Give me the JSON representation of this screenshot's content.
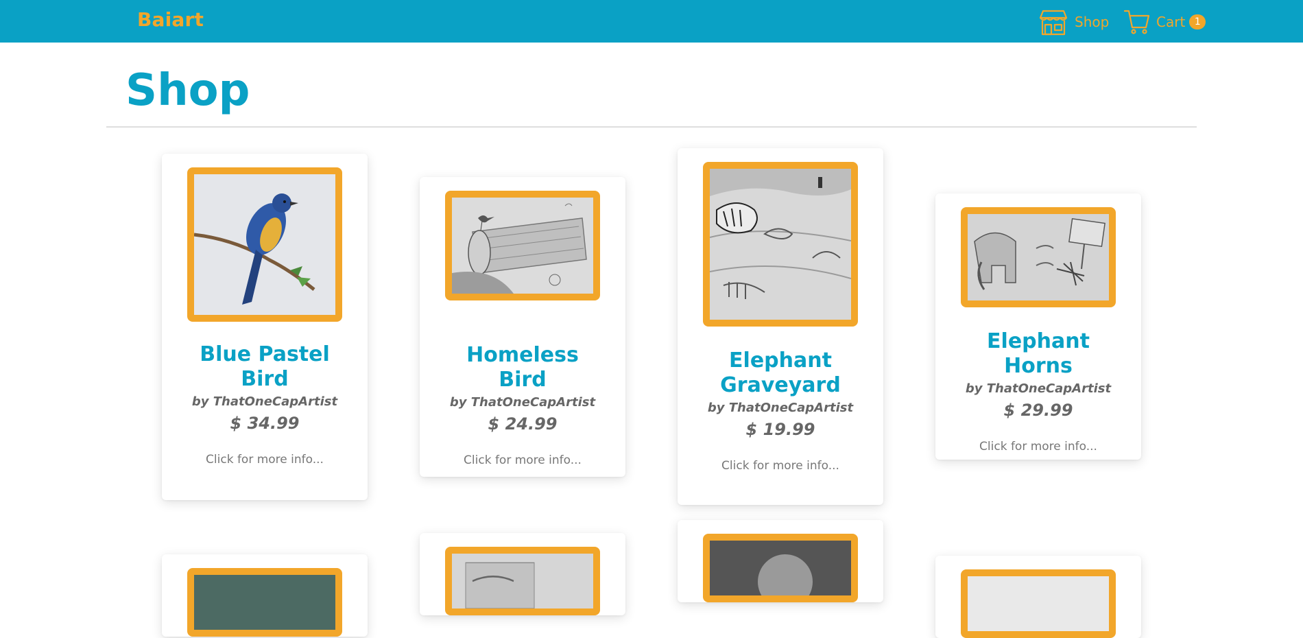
{
  "navbar": {
    "brand": "Baiart",
    "shop_label": "Shop",
    "cart_label": "Cart",
    "cart_count": "1",
    "background": "#0aa1c5",
    "accent": "#f2a62a"
  },
  "page": {
    "title": "Shop"
  },
  "products": [
    {
      "title": "Blue Pastel Bird",
      "artist": "by ThatOneCapArtist",
      "price": "$ 34.99",
      "more": "Click for more info...",
      "icon": "bird-on-branch-artwork"
    },
    {
      "title": "Homeless Bird",
      "artist": "by ThatOneCapArtist",
      "price": "$ 24.99",
      "more": "Click for more info...",
      "icon": "bird-on-log-artwork"
    },
    {
      "title": "Elephant Graveyard",
      "artist": "by ThatOneCapArtist",
      "price": "$ 19.99",
      "more": "Click for more info...",
      "icon": "tiger-graveyard-artwork"
    },
    {
      "title": "Elephant Horns",
      "artist": "by ThatOneCapArtist",
      "price": "$ 29.99",
      "more": "Click for more info...",
      "icon": "elephant-horns-artwork"
    }
  ]
}
